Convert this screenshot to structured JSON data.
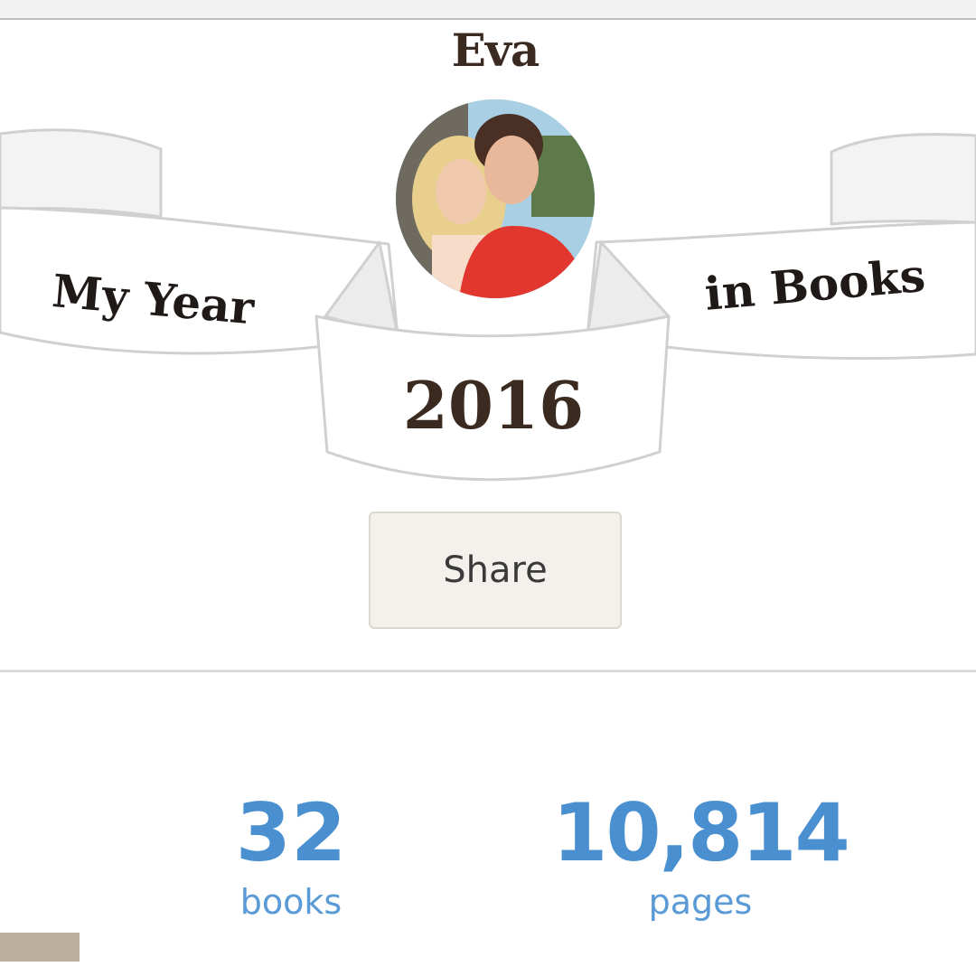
{
  "header": {
    "user_name": "Eva",
    "banner_left": "My Year",
    "banner_right": "in Books",
    "banner_year": "2016",
    "avatar_icon": "avatar-photo"
  },
  "actions": {
    "share_label": "Share"
  },
  "stats": [
    {
      "value": "32",
      "label": "books"
    },
    {
      "value": "10,814",
      "label": "pages"
    }
  ],
  "colors": {
    "stat_blue": "#4a90d0",
    "heading_brown": "#3b2a20",
    "button_bg": "#f4f1ec",
    "swatch": "#bcaf9c"
  }
}
